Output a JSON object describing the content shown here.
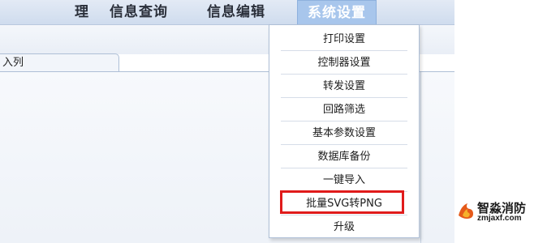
{
  "topmenu": {
    "partial_left": "理",
    "items": [
      "信息查询",
      "信息编辑"
    ],
    "active": "系统设置"
  },
  "tab": {
    "label": "入列"
  },
  "dropdown": {
    "items": [
      "打印设置",
      "控制器设置",
      "转发设置",
      "回路筛选",
      "基本参数设置",
      "数据库备份",
      "一键导入",
      "批量SVG转PNG",
      "升级"
    ],
    "highlighted_item": "批量SVG转PNG"
  },
  "watermark": {
    "name": "智淼消防",
    "url": "zmjaxf.com"
  },
  "colors": {
    "accent": "#a8c6ec",
    "highlight_border": "#e01b1b"
  }
}
